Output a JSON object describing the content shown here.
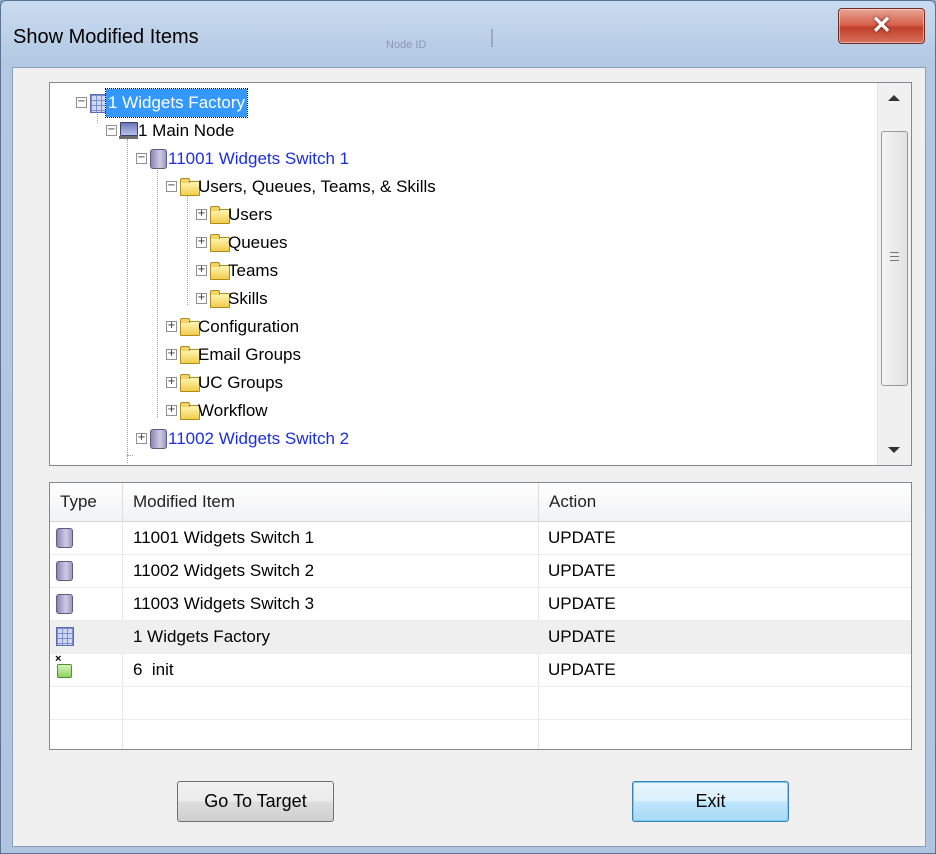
{
  "window": {
    "title": "Show Modified Items",
    "background_hint_text": "Node ID"
  },
  "tree": {
    "items": [
      {
        "label": "1 Widgets Factory",
        "icon": "factory-grid-icon",
        "expander": "−"
      },
      {
        "label": "1 Main Node",
        "icon": "computer-node-icon",
        "expander": "−"
      },
      {
        "label": "11001 Widgets Switch 1",
        "icon": "switch-cube-icon",
        "expander": "−"
      },
      {
        "label": "Users, Queues, Teams, & Skills",
        "icon": "folder-icon",
        "expander": "−"
      },
      {
        "label": "Users",
        "icon": "folder-icon",
        "expander": "+"
      },
      {
        "label": "Queues",
        "icon": "folder-icon",
        "expander": "+"
      },
      {
        "label": "Teams",
        "icon": "folder-icon",
        "expander": "+"
      },
      {
        "label": "Skills",
        "icon": "folder-icon",
        "expander": "+"
      },
      {
        "label": "Configuration",
        "icon": "folder-icon",
        "expander": "+"
      },
      {
        "label": "Email Groups",
        "icon": "folder-icon",
        "expander": "+"
      },
      {
        "label": "UC Groups",
        "icon": "folder-icon",
        "expander": "+"
      },
      {
        "label": "Workflow",
        "icon": "folder-icon",
        "expander": "+"
      },
      {
        "label": "11002 Widgets Switch 2",
        "icon": "switch-cube-icon",
        "expander": "+"
      }
    ]
  },
  "list": {
    "headers": {
      "type": "Type",
      "item": "Modified Item",
      "action": "Action"
    },
    "rows": [
      {
        "icon": "switch-cube-icon",
        "item": "11001 Widgets Switch 1",
        "action": "UPDATE"
      },
      {
        "icon": "switch-cube-icon",
        "item": "11002 Widgets Switch 2",
        "action": "UPDATE"
      },
      {
        "icon": "switch-cube-icon",
        "item": "11003 Widgets Switch 3",
        "action": "UPDATE"
      },
      {
        "icon": "factory-grid-icon",
        "item": "1 Widgets Factory",
        "action": "UPDATE"
      },
      {
        "icon": "init-object-icon",
        "item": "6  init",
        "action": "UPDATE"
      }
    ]
  },
  "buttons": {
    "go_to_target": "Go To Target",
    "exit": "Exit"
  },
  "colors": {
    "accent_blue_text": "#1b2ee0",
    "selection": "#3399ff",
    "close_button": "#c1402b"
  }
}
